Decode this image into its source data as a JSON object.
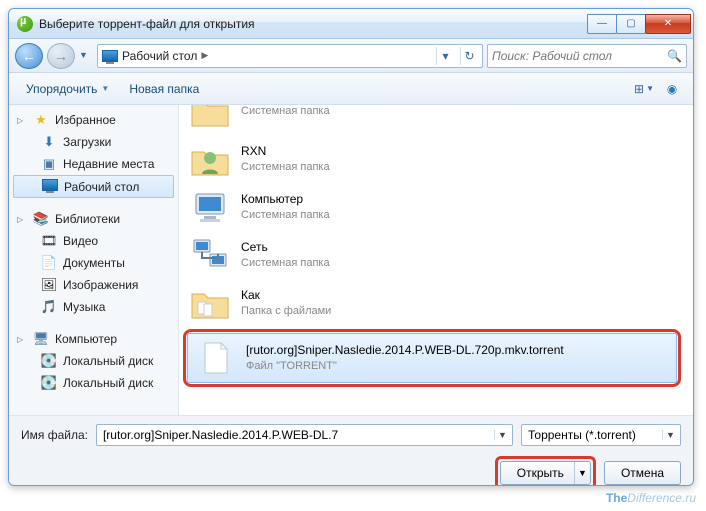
{
  "title": "Выберите торрент-файл для открытия",
  "breadcrumb": {
    "location": "Рабочий стол"
  },
  "search": {
    "placeholder": "Поиск: Рабочий стол"
  },
  "toolbar": {
    "organize": "Упорядочить",
    "newfolder": "Новая папка"
  },
  "sidebar": {
    "fav": {
      "header": "Избранное",
      "items": [
        "Загрузки",
        "Недавние места",
        "Рабочий стол"
      ]
    },
    "lib": {
      "header": "Библиотеки",
      "items": [
        "Видео",
        "Документы",
        "Изображения",
        "Музыка"
      ]
    },
    "pc": {
      "header": "Компьютер",
      "items": [
        "Локальный диск",
        "Локальный диск"
      ]
    }
  },
  "files": [
    {
      "name": "",
      "type": "Системная папка",
      "icon": "folder"
    },
    {
      "name": "RXN",
      "type": "Системная папка",
      "icon": "user"
    },
    {
      "name": "Компьютер",
      "type": "Системная папка",
      "icon": "computer"
    },
    {
      "name": "Сеть",
      "type": "Системная папка",
      "icon": "network"
    },
    {
      "name": "Как",
      "type": "Папка с файлами",
      "icon": "folder"
    },
    {
      "name": "[rutor.org]Sniper.Nasledie.2014.P.WEB-DL.720p.mkv.torrent",
      "type": "Файл \"TORRENT\"",
      "icon": "blank"
    }
  ],
  "footer": {
    "filename_label": "Имя файла:",
    "filename_value": "[rutor.org]Sniper.Nasledie.2014.P.WEB-DL.7",
    "filter": "Торренты (*.torrent)",
    "open": "Открыть",
    "cancel": "Отмена"
  },
  "watermark": {
    "a": "The",
    "b": "Difference",
    "c": ".ru"
  }
}
